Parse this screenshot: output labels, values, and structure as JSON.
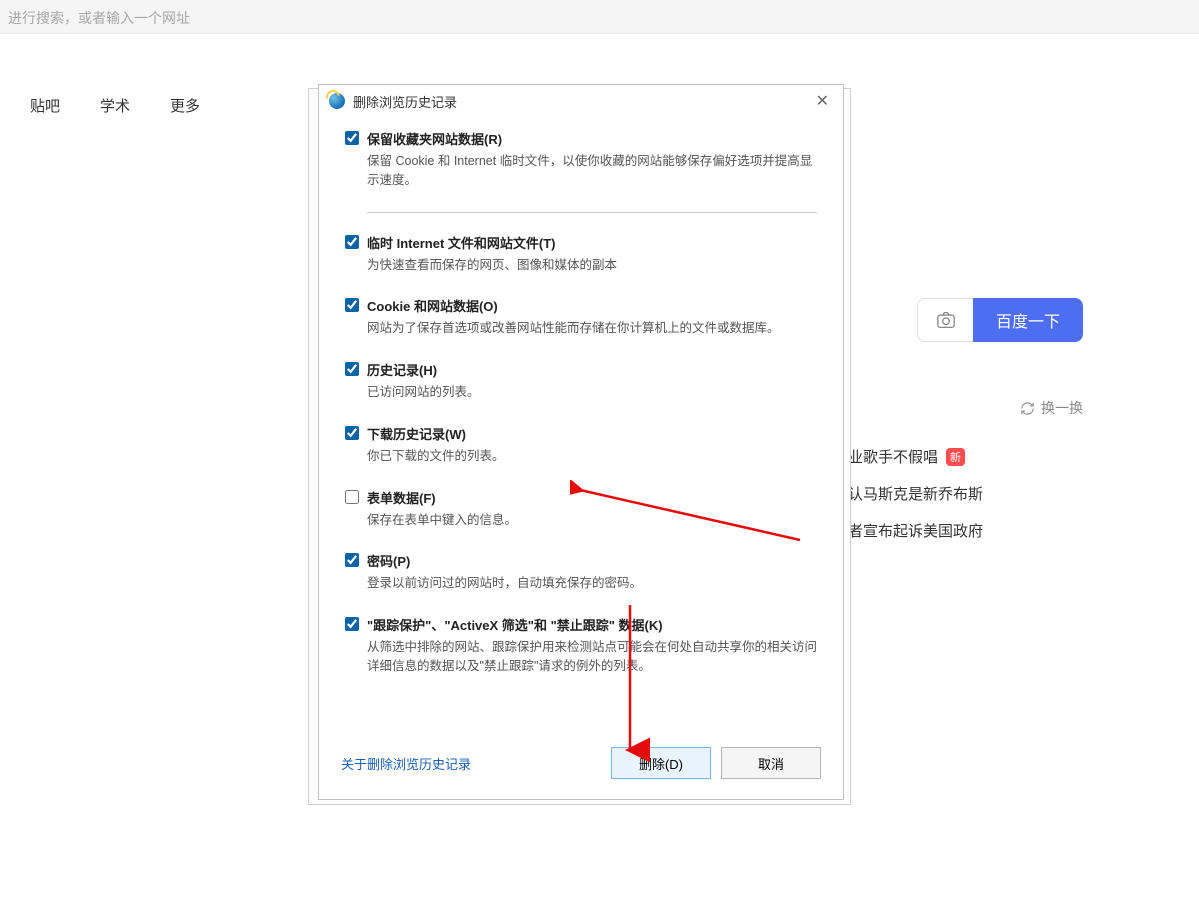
{
  "addressbar": {
    "placeholder": "进行搜索，或者输入一个网址"
  },
  "nav": {
    "tieba": "贴吧",
    "xueshu": "学术",
    "more": "更多"
  },
  "search": {
    "button": "百度一下"
  },
  "refresh": {
    "label": "换一换"
  },
  "news": {
    "items": [
      {
        "text": "业歌手不假唱",
        "badge": "新"
      },
      {
        "text": "认马斯克是新乔布斯"
      },
      {
        "text": "者宣布起诉美国政府"
      }
    ]
  },
  "dialog": {
    "title": "删除浏览历史记录",
    "options": [
      {
        "checked": true,
        "label": "保留收藏夹网站数据(R)",
        "desc": "保留 Cookie 和 Internet 临时文件，以使你收藏的网站能够保存偏好选项并提高显示速度。",
        "sep_after": true
      },
      {
        "checked": true,
        "label": "临时 Internet 文件和网站文件(T)",
        "desc": "为快速查看而保存的网页、图像和媒体的副本"
      },
      {
        "checked": true,
        "label": "Cookie 和网站数据(O)",
        "desc": "网站为了保存首选项或改善网站性能而存储在你计算机上的文件或数据库。"
      },
      {
        "checked": true,
        "label": "历史记录(H)",
        "desc": "已访问网站的列表。"
      },
      {
        "checked": true,
        "label": "下载历史记录(W)",
        "desc": "你已下载的文件的列表。"
      },
      {
        "checked": false,
        "label": "表单数据(F)",
        "desc": "保存在表单中键入的信息。"
      },
      {
        "checked": true,
        "label": "密码(P)",
        "desc": "登录以前访问过的网站时，自动填充保存的密码。"
      },
      {
        "checked": true,
        "label": "\"跟踪保护\"、\"ActiveX 筛选\"和 \"禁止跟踪\" 数据(K)",
        "desc": "从筛选中排除的网站、跟踪保护用来检测站点可能会在何处自动共享你的相关访问详细信息的数据以及\"禁止跟踪\"请求的例外的列表。"
      }
    ],
    "about_link": "关于删除浏览历史记录",
    "delete_btn": "删除(D)",
    "cancel_btn": "取消"
  }
}
